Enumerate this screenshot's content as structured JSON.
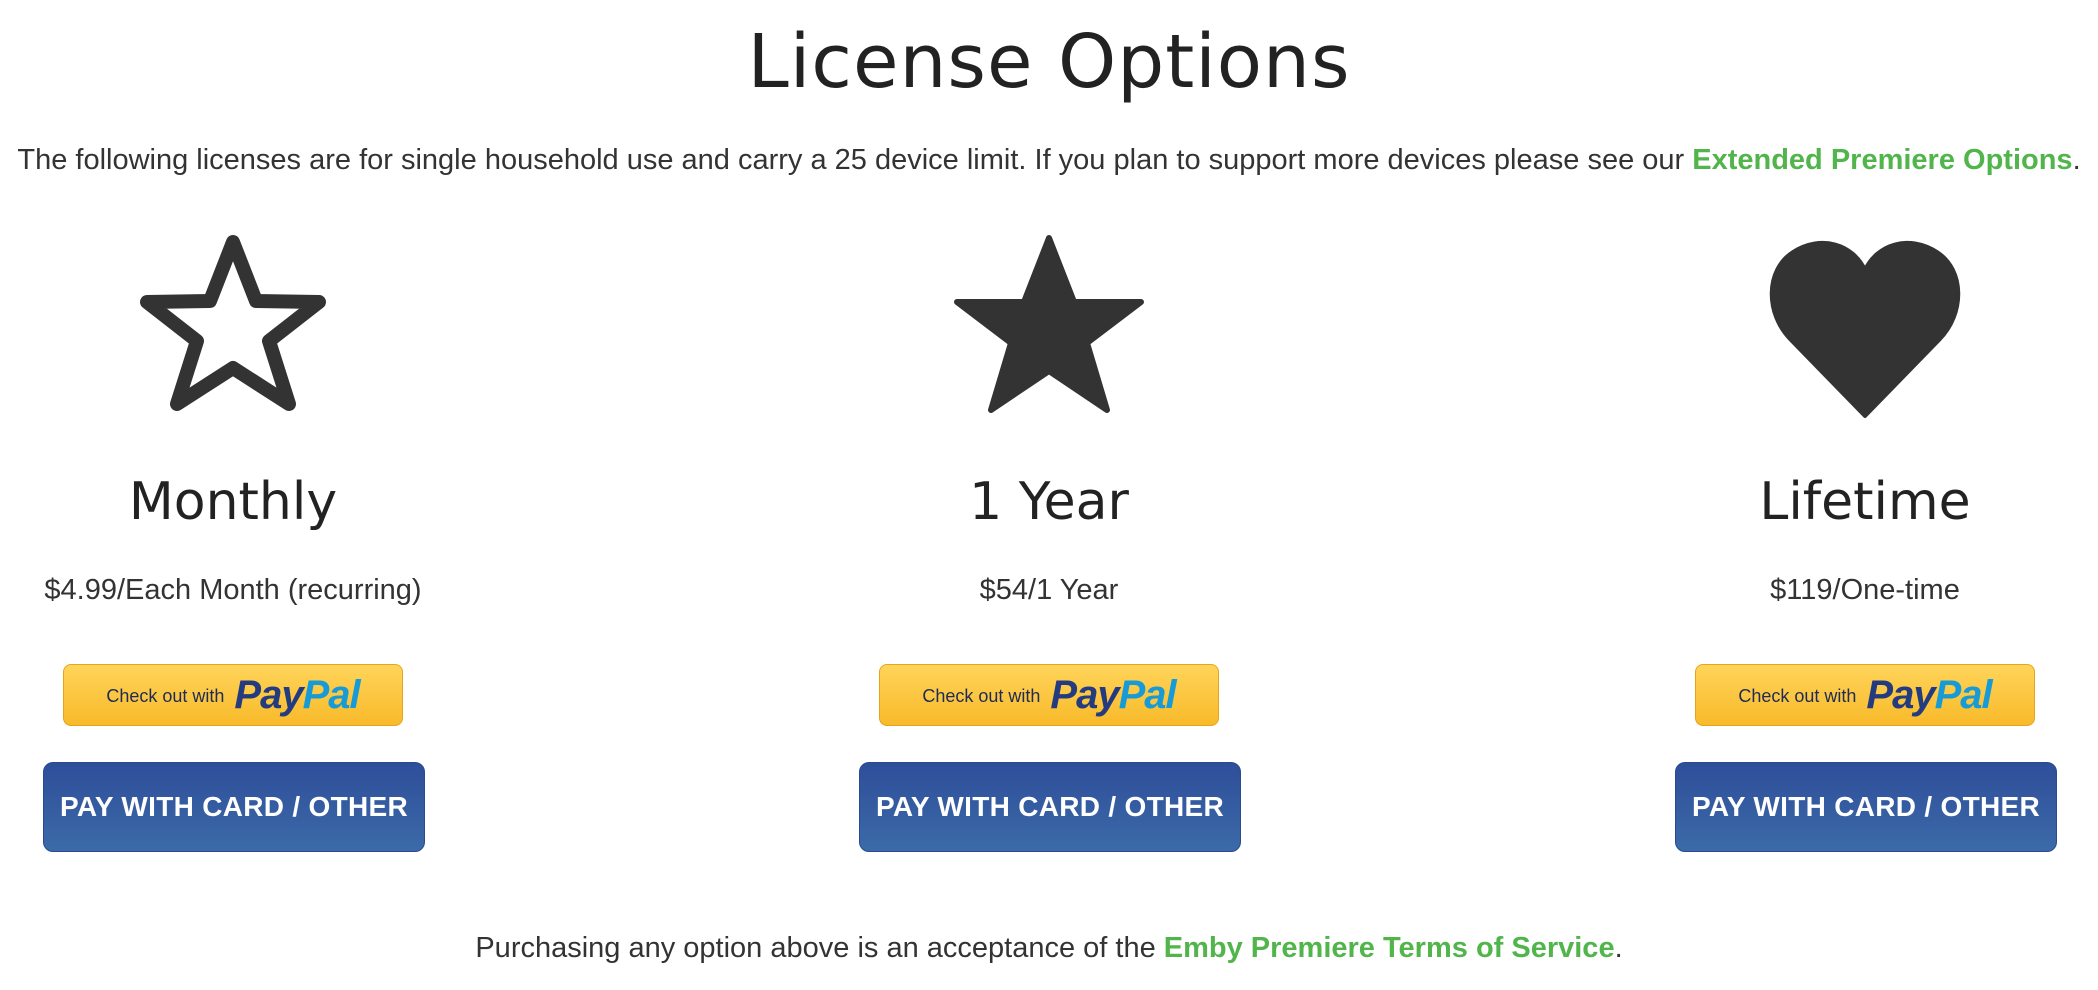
{
  "header": {
    "title": "License Options"
  },
  "intro": {
    "text_before": "The following licenses are for single household use and carry a 25 device limit. If you plan to support more devices please see our ",
    "link_label": "Extended Premiere Options",
    "text_after": "."
  },
  "plans": [
    {
      "icon": "star-outline-icon",
      "name": "Monthly",
      "price": "$4.99/Each Month (recurring)",
      "paypal_prefix": "Check out with",
      "paypal_pay": "Pay",
      "paypal_pal": "Pal",
      "card_button": "PAY WITH CARD / OTHER"
    },
    {
      "icon": "star-filled-icon",
      "name": "1 Year",
      "price": "$54/1 Year",
      "paypal_prefix": "Check out with",
      "paypal_pay": "Pay",
      "paypal_pal": "Pal",
      "card_button": "PAY WITH CARD / OTHER"
    },
    {
      "icon": "heart-icon",
      "name": "Lifetime",
      "price": "$119/One-time",
      "paypal_prefix": "Check out with",
      "paypal_pay": "Pay",
      "paypal_pal": "Pal",
      "card_button": "PAY WITH CARD / OTHER"
    }
  ],
  "footer": {
    "text_before": "Purchasing any option above is an acceptance of the ",
    "link_label": "Emby Premiere Terms of Service",
    "text_after": "."
  },
  "colors": {
    "link_green": "#52b54b",
    "icon_dark": "#333333",
    "paypal_yellow": "#ffc439",
    "paypal_dark_blue": "#253b80",
    "paypal_light_blue": "#179bd7",
    "card_button_blue": "#2e4e9a"
  }
}
